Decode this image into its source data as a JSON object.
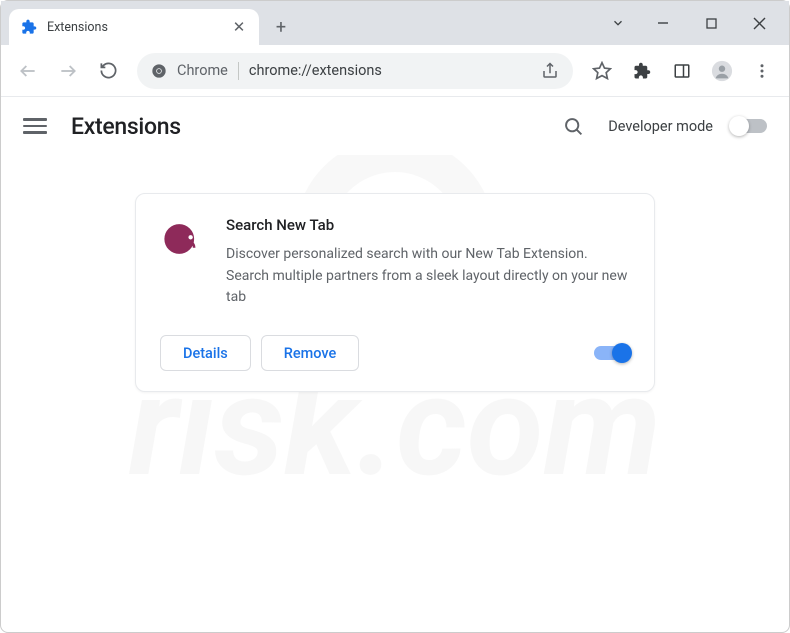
{
  "tab": {
    "title": "Extensions"
  },
  "omnibox": {
    "prefix": "Chrome",
    "url": "chrome://extensions"
  },
  "header": {
    "title": "Extensions",
    "devModeLabel": "Developer mode"
  },
  "extension": {
    "name": "Search New Tab",
    "description": "Discover personalized search with our New Tab Extension. Search multiple partners from a sleek layout directly on your new tab",
    "detailsLabel": "Details",
    "removeLabel": "Remove"
  },
  "watermark": {
    "text": "risk.com"
  }
}
